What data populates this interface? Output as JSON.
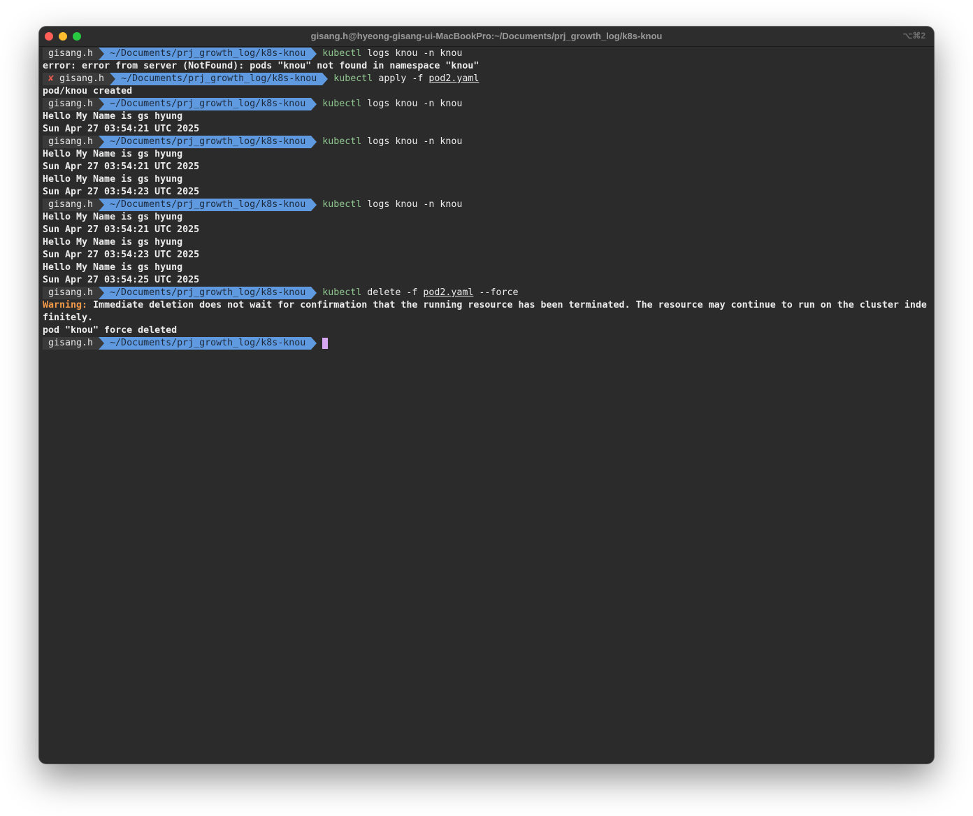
{
  "window": {
    "title": "gisang.h@hyeong-gisang-ui-MacBookPro:~/Documents/prj_growth_log/k8s-knou",
    "shortcut": "⌥⌘2"
  },
  "prompt": {
    "user": "gisang.h",
    "path": "~/Documents/prj_growth_log/k8s-knou",
    "error_mark": "✘"
  },
  "lines": [
    {
      "type": "prompt",
      "kw": "kubectl",
      "args": " logs knou -n knou"
    },
    {
      "type": "out",
      "text": "error: error from server (NotFound): pods \"knou\" not found in namespace \"knou\""
    },
    {
      "type": "prompt_err",
      "kw": "kubectl",
      "args": " apply -f ",
      "file": "pod2.yaml",
      "tail": ""
    },
    {
      "type": "out",
      "text": "pod/knou created"
    },
    {
      "type": "prompt",
      "kw": "kubectl",
      "args": " logs knou -n knou"
    },
    {
      "type": "out",
      "text": "Hello My Name is gs hyung"
    },
    {
      "type": "out",
      "text": "Sun Apr 27 03:54:21 UTC 2025"
    },
    {
      "type": "prompt",
      "kw": "kubectl",
      "args": " logs knou -n knou"
    },
    {
      "type": "out",
      "text": "Hello My Name is gs hyung"
    },
    {
      "type": "out",
      "text": "Sun Apr 27 03:54:21 UTC 2025"
    },
    {
      "type": "out",
      "text": "Hello My Name is gs hyung"
    },
    {
      "type": "out",
      "text": "Sun Apr 27 03:54:23 UTC 2025"
    },
    {
      "type": "prompt",
      "kw": "kubectl",
      "args": " logs knou -n knou"
    },
    {
      "type": "out",
      "text": "Hello My Name is gs hyung"
    },
    {
      "type": "out",
      "text": "Sun Apr 27 03:54:21 UTC 2025"
    },
    {
      "type": "out",
      "text": "Hello My Name is gs hyung"
    },
    {
      "type": "out",
      "text": "Sun Apr 27 03:54:23 UTC 2025"
    },
    {
      "type": "out",
      "text": "Hello My Name is gs hyung"
    },
    {
      "type": "out",
      "text": "Sun Apr 27 03:54:25 UTC 2025"
    },
    {
      "type": "prompt_file",
      "kw": "kubectl",
      "args": " delete -f ",
      "file": "pod2.yaml",
      "tail": " --force"
    },
    {
      "type": "warn",
      "label": "Warning:",
      "text": " Immediate deletion does not wait for confirmation that the running resource has been terminated. The resource may continue to run on the cluster inde"
    },
    {
      "type": "out",
      "text": "finitely."
    },
    {
      "type": "out",
      "text": "pod \"knou\" force deleted"
    },
    {
      "type": "prompt_cursor"
    }
  ],
  "colors": {
    "background": "#2b2b2b",
    "prompt_user_bg": "#3a3a3a",
    "prompt_path_bg": "#5f9ae0",
    "command": "#8fc68f",
    "warning": "#f29a4a",
    "cursor": "#d7a8f0"
  }
}
